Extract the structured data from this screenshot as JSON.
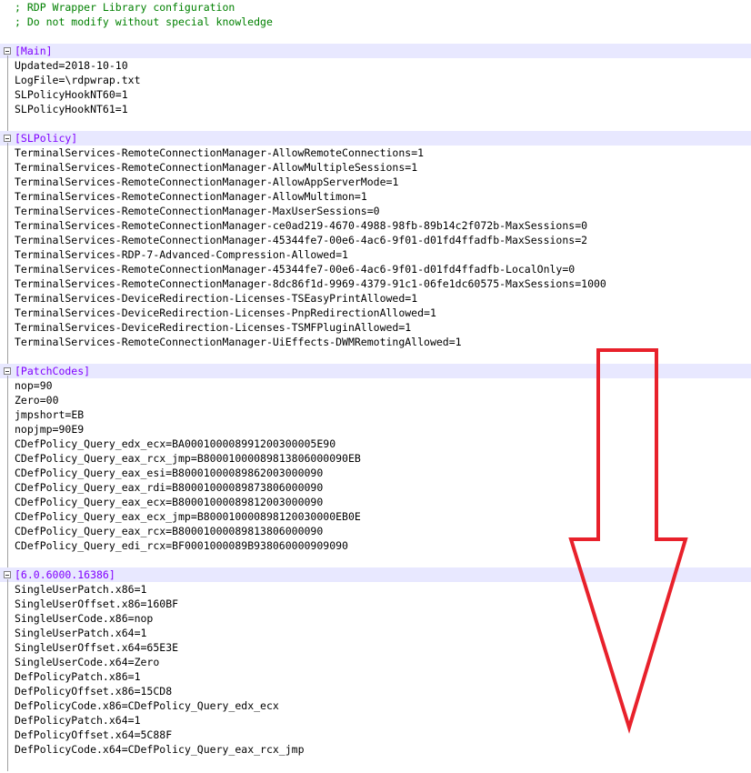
{
  "header_comments": [
    "; RDP Wrapper Library configuration",
    "; Do not modify without special knowledge"
  ],
  "sections": [
    {
      "name": "[Main]",
      "entries": [
        {
          "key": "Updated",
          "value": "2018-10-10"
        },
        {
          "key": "LogFile",
          "value": "\\rdpwrap.txt"
        },
        {
          "key": "SLPolicyHookNT60",
          "value": "1"
        },
        {
          "key": "SLPolicyHookNT61",
          "value": "1"
        }
      ]
    },
    {
      "name": "[SLPolicy]",
      "entries": [
        {
          "key": "TerminalServices-RemoteConnectionManager-AllowRemoteConnections",
          "value": "1"
        },
        {
          "key": "TerminalServices-RemoteConnectionManager-AllowMultipleSessions",
          "value": "1"
        },
        {
          "key": "TerminalServices-RemoteConnectionManager-AllowAppServerMode",
          "value": "1"
        },
        {
          "key": "TerminalServices-RemoteConnectionManager-AllowMultimon",
          "value": "1"
        },
        {
          "key": "TerminalServices-RemoteConnectionManager-MaxUserSessions",
          "value": "0"
        },
        {
          "key": "TerminalServices-RemoteConnectionManager-ce0ad219-4670-4988-98fb-89b14c2f072b-MaxSessions",
          "value": "0"
        },
        {
          "key": "TerminalServices-RemoteConnectionManager-45344fe7-00e6-4ac6-9f01-d01fd4ffadfb-MaxSessions",
          "value": "2"
        },
        {
          "key": "TerminalServices-RDP-7-Advanced-Compression-Allowed",
          "value": "1"
        },
        {
          "key": "TerminalServices-RemoteConnectionManager-45344fe7-00e6-4ac6-9f01-d01fd4ffadfb-LocalOnly",
          "value": "0"
        },
        {
          "key": "TerminalServices-RemoteConnectionManager-8dc86f1d-9969-4379-91c1-06fe1dc60575-MaxSessions",
          "value": "1000"
        },
        {
          "key": "TerminalServices-DeviceRedirection-Licenses-TSEasyPrintAllowed",
          "value": "1"
        },
        {
          "key": "TerminalServices-DeviceRedirection-Licenses-PnpRedirectionAllowed",
          "value": "1"
        },
        {
          "key": "TerminalServices-DeviceRedirection-Licenses-TSMFPluginAllowed",
          "value": "1"
        },
        {
          "key": "TerminalServices-RemoteConnectionManager-UiEffects-DWMRemotingAllowed",
          "value": "1"
        }
      ]
    },
    {
      "name": "[PatchCodes]",
      "entries": [
        {
          "key": "nop",
          "value": "90"
        },
        {
          "key": "Zero",
          "value": "00"
        },
        {
          "key": "jmpshort",
          "value": "EB"
        },
        {
          "key": "nopjmp",
          "value": "90E9"
        },
        {
          "key": "CDefPolicy_Query_edx_ecx",
          "value": "BA000100008991200300005E90"
        },
        {
          "key": "CDefPolicy_Query_eax_rcx_jmp",
          "value": "B80001000089813806000090EB"
        },
        {
          "key": "CDefPolicy_Query_eax_esi",
          "value": "B80001000089862003000090"
        },
        {
          "key": "CDefPolicy_Query_eax_rdi",
          "value": "B80001000089873806000090"
        },
        {
          "key": "CDefPolicy_Query_eax_ecx",
          "value": "B80001000089812003000090"
        },
        {
          "key": "CDefPolicy_Query_eax_ecx_jmp",
          "value": "B800010000898120030000EB0E"
        },
        {
          "key": "CDefPolicy_Query_eax_rcx",
          "value": "B80001000089813806000090"
        },
        {
          "key": "CDefPolicy_Query_edi_rcx",
          "value": "BF0001000089B938060000909090"
        }
      ]
    },
    {
      "name": "[6.0.6000.16386]",
      "entries": [
        {
          "key": "SingleUserPatch.x86",
          "value": "1"
        },
        {
          "key": "SingleUserOffset.x86",
          "value": "160BF"
        },
        {
          "key": "SingleUserCode.x86",
          "value": "nop"
        },
        {
          "key": "SingleUserPatch.x64",
          "value": "1"
        },
        {
          "key": "SingleUserOffset.x64",
          "value": "65E3E"
        },
        {
          "key": "SingleUserCode.x64",
          "value": "Zero"
        },
        {
          "key": "DefPolicyPatch.x86",
          "value": "1"
        },
        {
          "key": "DefPolicyOffset.x86",
          "value": "15CD8"
        },
        {
          "key": "DefPolicyCode.x86",
          "value": "CDefPolicy_Query_edx_ecx"
        },
        {
          "key": "DefPolicyPatch.x64",
          "value": "1"
        },
        {
          "key": "DefPolicyOffset.x64",
          "value": "5C88F"
        },
        {
          "key": "DefPolicyCode.x64",
          "value": "CDefPolicy_Query_eax_rcx_jmp"
        }
      ]
    }
  ],
  "colors": {
    "comment": "#008000",
    "section": "#8000ff",
    "section_band": "#e8e8ff",
    "arrow": "#e8212b"
  },
  "annotation_icon": "down-arrow-icon"
}
